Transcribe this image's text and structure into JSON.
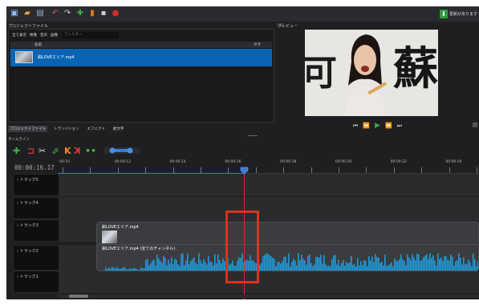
{
  "toolbar": {
    "buttons": [
      {
        "name": "new-project-icon",
        "glyph": "▣",
        "color": "#8cc0ff"
      },
      {
        "name": "open-project-icon",
        "glyph": "▰",
        "color": "#e0a24a"
      },
      {
        "name": "save-project-icon",
        "glyph": "▤",
        "color": "#9ab0c8"
      },
      {
        "name": "undo-icon",
        "glyph": "↶",
        "color": "#e05454"
      },
      {
        "name": "redo-icon",
        "glyph": "↷",
        "color": "#cfcfcf"
      },
      {
        "name": "import-files-icon",
        "glyph": "✚",
        "color": "#3fb24c"
      },
      {
        "name": "choose-profile-icon",
        "glyph": "▮",
        "color": "#e07b2a"
      },
      {
        "name": "fullscreen-icon",
        "glyph": "▪",
        "color": "#cfcfcf"
      },
      {
        "name": "export-video-icon",
        "glyph": "●",
        "color": "#d62a2a"
      }
    ],
    "update_label": "更新があります"
  },
  "project_files": {
    "title": "プロジェクトファイル",
    "filters": [
      "全て表示",
      "映像",
      "音声",
      "画像"
    ],
    "filter_placeholder": "フィルター",
    "columns": {
      "name": "名前",
      "tags": "タグ"
    },
    "items": [
      {
        "name": "鈎LOVEエリア.mp4"
      }
    ],
    "divider_label": "⊡⊡"
  },
  "preview": {
    "title": "プレビュー",
    "sign_left": "可",
    "sign_right": "蘇",
    "controls": [
      "⏮",
      "⏪",
      "▶",
      "⏩",
      "⏭"
    ]
  },
  "tabs": [
    {
      "label": "プロジェクトファイル",
      "active": true
    },
    {
      "label": "トランジション",
      "active": false
    },
    {
      "label": "エフェクト",
      "active": false
    },
    {
      "label": "絵文字",
      "active": false
    }
  ],
  "timeline": {
    "title": "タイムライン",
    "tools": [
      {
        "name": "add-track-icon",
        "glyph": "✚",
        "color": "#3fb24c"
      },
      {
        "name": "snap-icon",
        "glyph": "⊐",
        "color": "#e03838"
      },
      {
        "name": "razor-icon",
        "glyph": "✂",
        "color": "#d9d9d9"
      },
      {
        "name": "add-marker-icon",
        "glyph": "⬀",
        "color": "#3fb24c"
      },
      {
        "name": "previous-marker-icon",
        "glyph": "K",
        "color": "#f08a2a"
      },
      {
        "name": "next-marker-icon",
        "glyph": "K",
        "color": "#e03838"
      },
      {
        "name": "center-playhead-icon",
        "glyph": "••",
        "color": "#3fb24c"
      }
    ],
    "timecode": "00:00:16.17",
    "ruler_labels": [
      {
        "text": "00:10",
        "pos": 0.0
      },
      {
        "text": "00:00:12",
        "pos": 0.131
      },
      {
        "text": "00:00:14",
        "pos": 0.262
      },
      {
        "text": "00:00:16",
        "pos": 0.393
      },
      {
        "text": "00:00:18",
        "pos": 0.524
      },
      {
        "text": "00:00:20",
        "pos": 0.655
      },
      {
        "text": "00:00:22",
        "pos": 0.786
      },
      {
        "text": "00:00:24",
        "pos": 0.917
      }
    ],
    "tracks": [
      {
        "label": "トラック5"
      },
      {
        "label": "トラック4"
      },
      {
        "label": "トラック3"
      },
      {
        "label": "トラック2"
      },
      {
        "label": "トラック1"
      }
    ],
    "clip_video": "鈎LOVEエリア.mp4",
    "clip_audio": "鈎LOVEエリア.mp4 (全てのチャンネル)",
    "waveform_color": "#1f9ad8",
    "playhead_color": "#d12b2b",
    "highlight_color": "#e0301f"
  }
}
